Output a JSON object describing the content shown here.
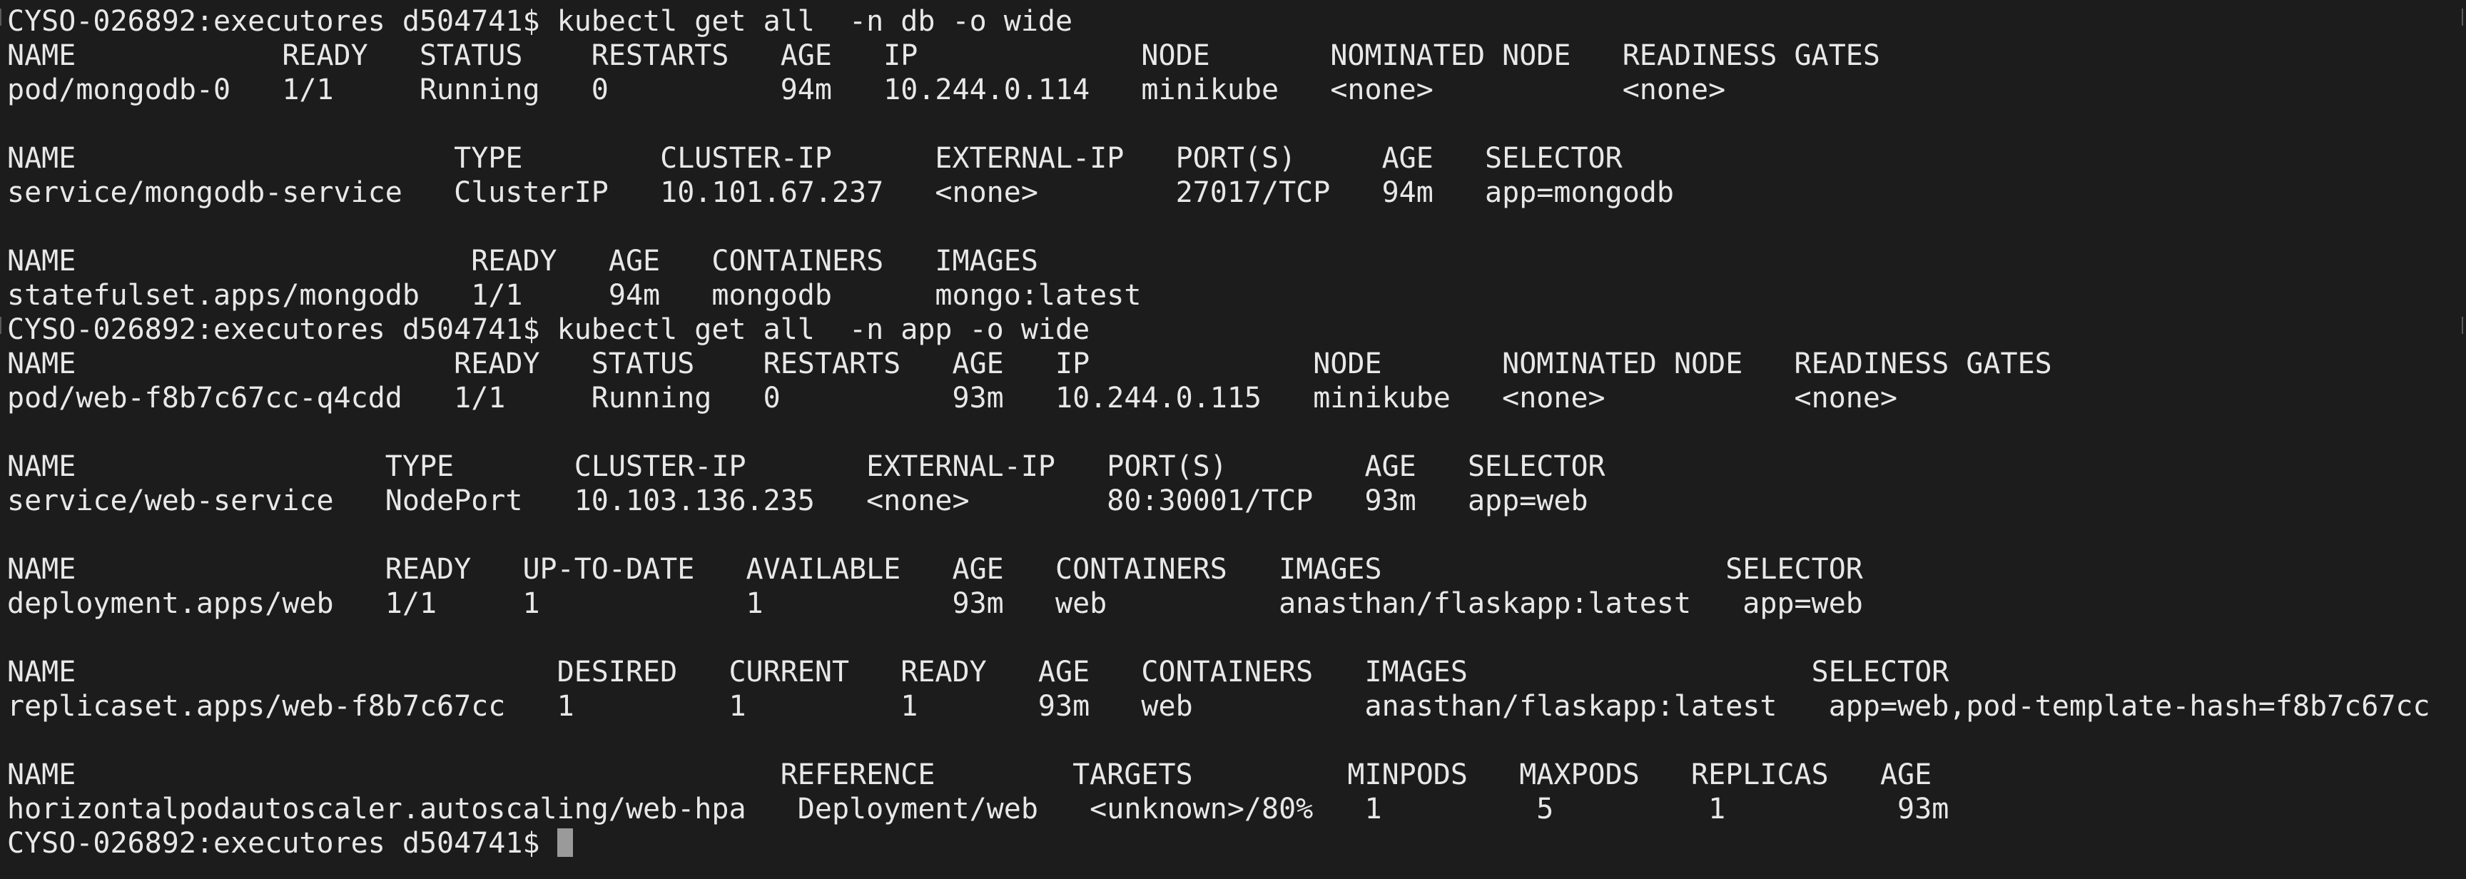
{
  "terminal": {
    "lines": [
      "CYSO-026892:executores d504741$ kubectl get all  -n db -o wide",
      "NAME            READY   STATUS    RESTARTS   AGE   IP             NODE       NOMINATED NODE   READINESS GATES",
      "pod/mongodb-0   1/1     Running   0          94m   10.244.0.114   minikube   <none>           <none>",
      "",
      "NAME                      TYPE        CLUSTER-IP      EXTERNAL-IP   PORT(S)     AGE   SELECTOR",
      "service/mongodb-service   ClusterIP   10.101.67.237   <none>        27017/TCP   94m   app=mongodb",
      "",
      "NAME                       READY   AGE   CONTAINERS   IMAGES",
      "statefulset.apps/mongodb   1/1     94m   mongodb      mongo:latest",
      "CYSO-026892:executores d504741$ kubectl get all  -n app -o wide",
      "NAME                      READY   STATUS    RESTARTS   AGE   IP             NODE       NOMINATED NODE   READINESS GATES",
      "pod/web-f8b7c67cc-q4cdd   1/1     Running   0          93m   10.244.0.115   minikube   <none>           <none>",
      "",
      "NAME                  TYPE       CLUSTER-IP       EXTERNAL-IP   PORT(S)        AGE   SELECTOR",
      "service/web-service   NodePort   10.103.136.235   <none>        80:30001/TCP   93m   app=web",
      "",
      "NAME                  READY   UP-TO-DATE   AVAILABLE   AGE   CONTAINERS   IMAGES                    SELECTOR",
      "deployment.apps/web   1/1     1            1           93m   web          anasthan/flaskapp:latest   app=web",
      "",
      "NAME                            DESIRED   CURRENT   READY   AGE   CONTAINERS   IMAGES                    SELECTOR",
      "replicaset.apps/web-f8b7c67cc   1         1         1       93m   web          anasthan/flaskapp:latest   app=web,pod-template-hash=f8b7c67cc",
      "",
      "NAME                                         REFERENCE        TARGETS         MINPODS   MAXPODS   REPLICAS   AGE",
      "horizontalpodautoscaler.autoscaling/web-hpa   Deployment/web   <unknown>/80%   1         5         1          93m"
    ],
    "prompt": "CYSO-026892:executores d504741$ ",
    "colors": {
      "background": "#1c1c1c",
      "text": "#e8e8e8",
      "cursor": "#9a9a9a"
    }
  }
}
